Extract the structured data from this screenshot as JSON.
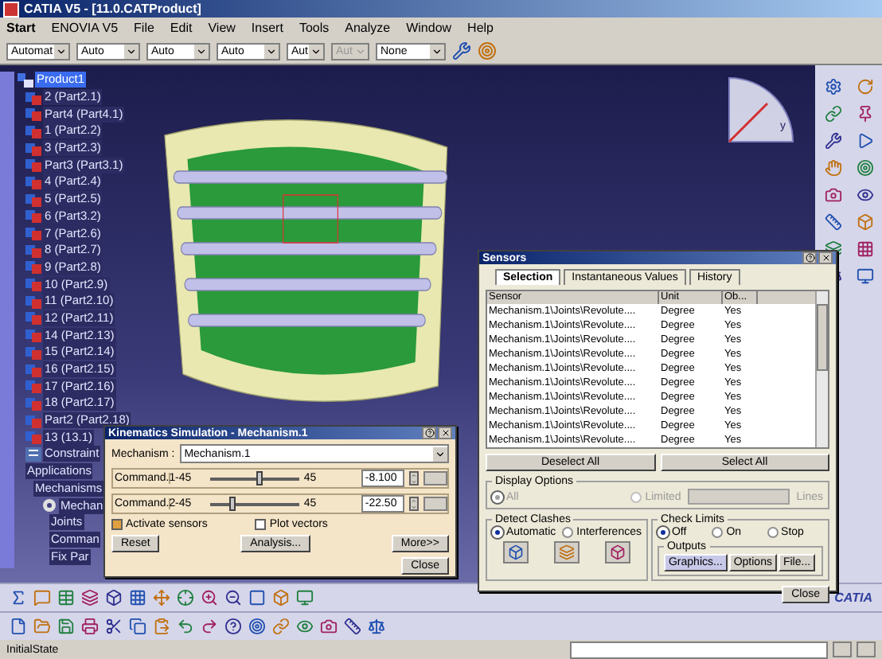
{
  "window": {
    "title": "CATIA V5 - [11.0.CATProduct]"
  },
  "menu": [
    "Start",
    "ENOVIA V5",
    "File",
    "Edit",
    "View",
    "Insert",
    "Tools",
    "Analyze",
    "Window",
    "Help"
  ],
  "toolbar_combos": [
    {
      "value": "Automat",
      "disabled": false
    },
    {
      "value": "Auto",
      "disabled": false
    },
    {
      "value": "Auto",
      "disabled": false
    },
    {
      "value": "Auto",
      "disabled": false
    },
    {
      "value": "Aut",
      "disabled": false
    },
    {
      "value": "Aut",
      "disabled": true
    },
    {
      "value": "None",
      "disabled": false
    }
  ],
  "compass": {
    "axis_label": "y"
  },
  "tree": {
    "label": "Product1",
    "kind": "product",
    "selected": true,
    "children": [
      {
        "label": "2 (Part2.1)",
        "kind": "part",
        "selected": false
      },
      {
        "label": "Part4 (Part4.1)",
        "kind": "part",
        "selected": false
      },
      {
        "label": "1 (Part2.2)",
        "kind": "part",
        "selected": false
      },
      {
        "label": "3 (Part2.3)",
        "kind": "part",
        "selected": false
      },
      {
        "label": "Part3 (Part3.1)",
        "kind": "part",
        "selected": false
      },
      {
        "label": "4 (Part2.4)",
        "kind": "part",
        "selected": false
      },
      {
        "label": "5 (Part2.5)",
        "kind": "part",
        "selected": false
      },
      {
        "label": "6 (Part3.2)",
        "kind": "part",
        "selected": false
      },
      {
        "label": "7 (Part2.6)",
        "kind": "part",
        "selected": false
      },
      {
        "label": "8 (Part2.7)",
        "kind": "part",
        "selected": false
      },
      {
        "label": "9 (Part2.8)",
        "kind": "part",
        "selected": false
      },
      {
        "label": "10 (Part2.9)",
        "kind": "part",
        "selected": false
      },
      {
        "label": "11 (Part2.10)",
        "kind": "part",
        "selected": false
      },
      {
        "label": "12 (Part2.11)",
        "kind": "part",
        "selected": false
      },
      {
        "label": "14 (Part2.13)",
        "kind": "part",
        "selected": false
      },
      {
        "label": "15 (Part2.14)",
        "kind": "part",
        "selected": false
      },
      {
        "label": "16 (Part2.15)",
        "kind": "part",
        "selected": false
      },
      {
        "label": "17 (Part2.16)",
        "kind": "part",
        "selected": false
      },
      {
        "label": "18 (Part2.17)",
        "kind": "part",
        "selected": false
      },
      {
        "label": "Part2 (Part2.18)",
        "kind": "part",
        "selected": false
      },
      {
        "label": "13 (13.1)",
        "kind": "part",
        "selected": false
      },
      {
        "label": "Constraint",
        "kind": "constraint",
        "selected": false
      },
      {
        "label": "Applications",
        "selected": false,
        "children": [
          {
            "label": "Mechanisms",
            "selected": false,
            "children": [
              {
                "label": "Mechan",
                "kind": "mechanism",
                "selected": false,
                "children": [
                  {
                    "label": "Joints",
                    "selected": false
                  },
                  {
                    "label": "Comman",
                    "selected": false
                  },
                  {
                    "label": "Fix Par",
                    "selected": false
                  }
                ]
              }
            ]
          }
        ]
      }
    ]
  },
  "kinematics": {
    "title": "Kinematics Simulation - Mechanism.1",
    "mechanism_label": "Mechanism :",
    "mechanism": "Mechanism.1",
    "commands": [
      {
        "label": "Command.1",
        "min": "-45",
        "max": "45",
        "level": 0.55,
        "value": "-8.100"
      },
      {
        "label": "Command.2",
        "min": "-45",
        "max": "45",
        "level": 0.25,
        "value": "-22.50"
      }
    ],
    "checks": [
      {
        "label": "Activate sensors",
        "checked": true
      },
      {
        "label": "Plot vectors",
        "checked": false
      }
    ],
    "buttons": [
      "Reset",
      "Analysis...",
      "More>>"
    ],
    "close": "Close"
  },
  "sensors": {
    "title": "Sensors",
    "tabs": [
      {
        "label": "Selection",
        "selected": true
      },
      {
        "label": "Instantaneous Values",
        "selected": false
      },
      {
        "label": "History",
        "selected": false
      }
    ],
    "columns": [
      "Sensor",
      "Unit",
      "Ob..."
    ],
    "rows": [
      [
        "Mechanism.1\\Joints\\Revolute....",
        "Degree",
        "Yes"
      ],
      [
        "Mechanism.1\\Joints\\Revolute....",
        "Degree",
        "Yes"
      ],
      [
        "Mechanism.1\\Joints\\Revolute....",
        "Degree",
        "Yes"
      ],
      [
        "Mechanism.1\\Joints\\Revolute....",
        "Degree",
        "Yes"
      ],
      [
        "Mechanism.1\\Joints\\Revolute....",
        "Degree",
        "Yes"
      ],
      [
        "Mechanism.1\\Joints\\Revolute....",
        "Degree",
        "Yes"
      ],
      [
        "Mechanism.1\\Joints\\Revolute....",
        "Degree",
        "Yes"
      ],
      [
        "Mechanism.1\\Joints\\Revolute....",
        "Degree",
        "Yes"
      ],
      [
        "Mechanism.1\\Joints\\Revolute....",
        "Degree",
        "Yes"
      ],
      [
        "Mechanism.1\\Joints\\Revolute....",
        "Degree",
        "Yes"
      ]
    ],
    "buttons": [
      "Deselect All",
      "Select All"
    ],
    "display_options": {
      "title": "Display Options",
      "options": [
        {
          "label": "All",
          "selected": true,
          "disabled": true
        },
        {
          "label": "Limited",
          "selected": false,
          "disabled": true
        }
      ],
      "lines_label": "Lines"
    },
    "detect_clashes": {
      "title": "Detect Clashes",
      "options": [
        {
          "label": "Automatic",
          "selected": true
        },
        {
          "label": "Interferences",
          "selected": false
        }
      ]
    },
    "check_limits": {
      "title": "Check Limits",
      "options": [
        {
          "label": "Off",
          "selected": true
        },
        {
          "label": "On",
          "selected": false
        },
        {
          "label": "Stop",
          "selected": false
        }
      ]
    },
    "outputs": {
      "title": "Outputs",
      "buttons": [
        {
          "label": "Graphics...",
          "selected": true
        },
        {
          "label": "Options",
          "selected": false
        },
        {
          "label": "File...",
          "selected": false
        }
      ]
    },
    "close": "Close"
  },
  "brand": "CATIA",
  "status_bar": {
    "text": "InitialState"
  }
}
